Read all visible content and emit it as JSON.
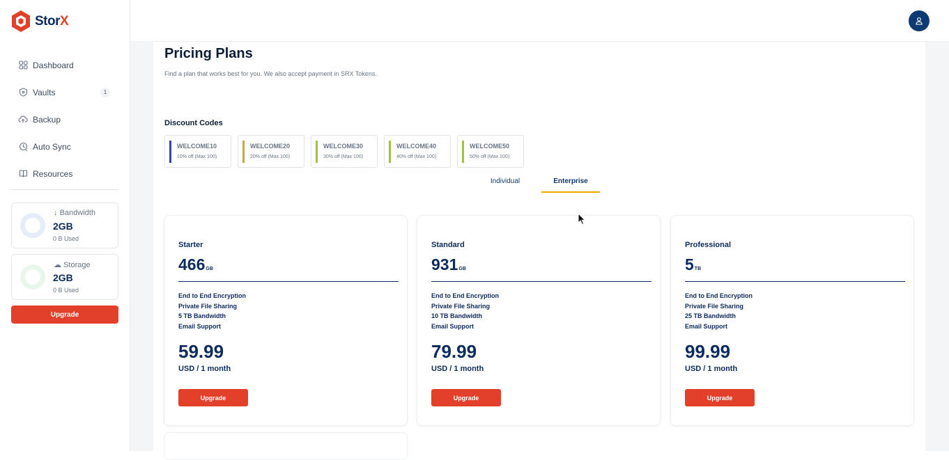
{
  "brand": {
    "name_prefix": "Stor",
    "name_suffix": "X",
    "accent": "#e2402a",
    "primary": "#0d2b5c"
  },
  "sidebar": {
    "items": [
      {
        "label": "Dashboard",
        "icon": "grid-icon"
      },
      {
        "label": "Vaults",
        "icon": "shield-icon",
        "badge": "1"
      },
      {
        "label": "Backup",
        "icon": "cloud-upload-icon"
      },
      {
        "label": "Auto Sync",
        "icon": "sync-icon"
      },
      {
        "label": "Resources",
        "icon": "book-icon"
      }
    ],
    "bandwidth": {
      "label": "Bandwidth",
      "value": "2GB",
      "used": "0 B Used"
    },
    "storage": {
      "label": "Storage",
      "value": "2GB",
      "used": "0 B Used"
    },
    "upgrade_label": "Upgrade"
  },
  "page": {
    "title": "Pricing Plans",
    "subtitle": "Find a plan that works best for you. We also accept payment in SRX Tokens.",
    "discount_title": "Discount Codes",
    "codes": [
      {
        "name": "WELCOME10",
        "desc": "10% off (Max 100)",
        "color": "#3b3fa8"
      },
      {
        "name": "WELCOME20",
        "desc": "20% off (Max 100)",
        "color": "#c9a850"
      },
      {
        "name": "WELCOME30",
        "desc": "30% off (Max 100)",
        "color": "#9fc14a"
      },
      {
        "name": "WELCOME40",
        "desc": "40% off (Max 100)",
        "color": "#9fc14a"
      },
      {
        "name": "WELCOME50",
        "desc": "50% off (Max 100)",
        "color": "#9fc14a"
      }
    ],
    "tabs": [
      "Individual",
      "Enterprise"
    ],
    "active_tab": "Enterprise",
    "plans": [
      {
        "name": "Starter",
        "size": "466",
        "unit": "GB",
        "features": [
          "End to End Encryption",
          "Private File Sharing",
          "5 TB Bandwidth",
          "Email Support"
        ],
        "price": "59.99",
        "period": "USD / 1 month",
        "button": "Upgrade"
      },
      {
        "name": "Standard",
        "size": "931",
        "unit": "GB",
        "features": [
          "End to End Encryption",
          "Private File Sharing",
          "10 TB Bandwidth",
          "Email Support"
        ],
        "price": "79.99",
        "period": "USD / 1 month",
        "button": "Upgrade"
      },
      {
        "name": "Professional",
        "size": "5",
        "unit": "TB",
        "features": [
          "End to End Encryption",
          "Private File Sharing",
          "25 TB Bandwidth",
          "Email Support"
        ],
        "price": "99.99",
        "period": "USD / 1 month",
        "button": "Upgrade"
      }
    ]
  }
}
